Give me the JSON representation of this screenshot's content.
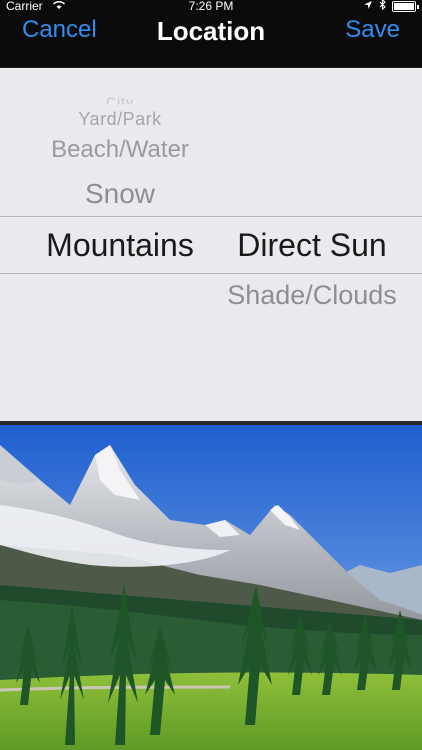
{
  "status": {
    "carrier": "Carrier",
    "time": "7:26 PM"
  },
  "nav": {
    "cancel": "Cancel",
    "title": "Location",
    "save": "Save"
  },
  "picker": {
    "location_items": [
      "City",
      "Yard/Park",
      "Beach/Water",
      "Snow",
      "Mountains"
    ],
    "location_selected": "Mountains",
    "light_items": [
      "Direct Sun",
      "Shade/Clouds"
    ],
    "light_selected": "Direct Sun"
  },
  "photo": {
    "subject": "mountain landscape with pine trees"
  },
  "colors": {
    "accent": "#2f8ef3",
    "nav_bg": "#0b0b0b",
    "picker_bg": "#e9e9ee"
  }
}
